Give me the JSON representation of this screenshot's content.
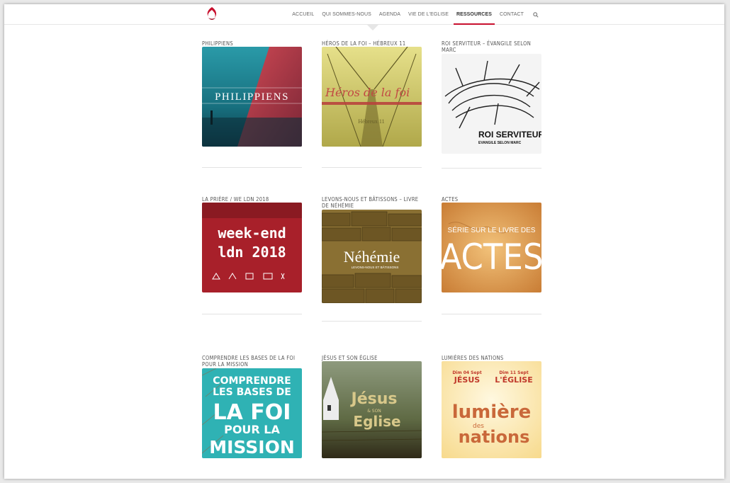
{
  "nav": {
    "items": [
      {
        "label": "ACCUEIL"
      },
      {
        "label": "QUI SOMMES-NOUS"
      },
      {
        "label": "AGENDA"
      },
      {
        "label": "VIE DE L'EGLISE"
      },
      {
        "label": "RESSOURCES"
      },
      {
        "label": "CONTACT"
      }
    ],
    "active": "RESSOURCES"
  },
  "colors": {
    "accent": "#c8102e"
  },
  "resources": [
    {
      "title": "PHILIPPIENS",
      "art": {
        "main": "PHILIPPIENS"
      }
    },
    {
      "title": "HÉROS DE LA FOI – HÉBREUX 11",
      "art": {
        "main": "Héros de la foi",
        "sub": "Hébreux 11"
      }
    },
    {
      "title": "ROI SERVITEUR – ÉVANGILE SELON MARC",
      "art": {
        "main": "ROI SERVITEUR",
        "sub": "EVANGILE SELON MARC"
      }
    },
    {
      "title": "LA PRIÈRE / WE LDN 2018",
      "art": {
        "main": "week-end",
        "sub": "ldn 2018"
      }
    },
    {
      "title": "LEVONS-NOUS ET BÂTISSONS – LIVRE DE NÉHÉMIE",
      "art": {
        "main": "Néhémie",
        "sub": "LEVONS-NOUS ET BÂTISSONS"
      }
    },
    {
      "title": "ACTES",
      "art": {
        "main": "ACTES",
        "sub": "SÉRIE SUR LE LIVRE DES"
      }
    },
    {
      "title": "COMPRENDRE LES BASES DE LA FOI POUR LA MISSION",
      "art": {
        "lines": [
          "COMPRENDRE",
          "LES BASES DE",
          "LA FOI",
          "POUR LA",
          "MISSION"
        ]
      }
    },
    {
      "title": "JÉSUS ET SON ÉGLISE",
      "art": {
        "main": "Jésus",
        "mid": "& SON",
        "sub": "Eglise"
      }
    },
    {
      "title": "LUMIÈRES DES NATIONS",
      "art": {
        "d1": "Dim 04 Sept",
        "d2": "Dim 11 Sept",
        "w1": "JÉSUS",
        "w2": "L'ÉGLISE",
        "l1": "lumière",
        "l2": "des",
        "l3": "nations"
      }
    }
  ]
}
